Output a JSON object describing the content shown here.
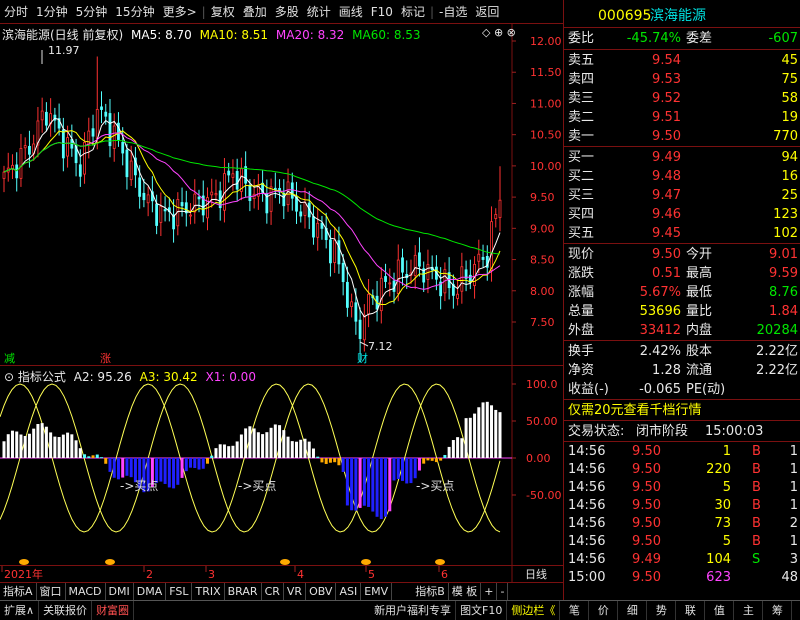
{
  "toolbar": {
    "items": [
      "分时",
      "1分钟",
      "5分钟",
      "15分钟",
      "更多>",
      "复权",
      "叠加",
      "多股",
      "统计",
      "画线",
      "F10",
      "标记",
      "-自选",
      "返回"
    ]
  },
  "main": {
    "title": "滨海能源(日线 前复权)",
    "ma5": "MA5: 8.70",
    "ma10": "MA10: 8.51",
    "ma20": "MA20: 8.32",
    "ma60": "MA60: 8.53",
    "high_label": "11.97",
    "low_label": "7.12",
    "marker_jian": "减",
    "marker_zhang": "涨",
    "marker_cai": "财",
    "price_ticks": [
      "12.00",
      "11.50",
      "11.00",
      "10.50",
      "10.00",
      "9.50",
      "9.00",
      "8.50",
      "8.00",
      "7.50"
    ]
  },
  "sub": {
    "title": "指标公式",
    "a2": "A2: 95.26",
    "a3": "A3: 30.42",
    "x1": "X1: 0.00",
    "ticks": [
      "100.0",
      "50.00",
      "0.00",
      "-50.00"
    ],
    "buy_label": "买点"
  },
  "time_axis": {
    "labels": [
      "2021年",
      "2",
      "3",
      "4",
      "5",
      "6"
    ],
    "period": "日线"
  },
  "tabs": [
    "指标A",
    "窗口",
    "MACD",
    "DMI",
    "DMA",
    "FSL",
    "TRIX",
    "BRAR",
    "CR",
    "VR",
    "OBV",
    "ASI",
    "EMV",
    "指标B",
    "模 板",
    "+",
    "-"
  ],
  "status": {
    "items": [
      "扩展∧",
      "关联报价",
      "财富圈",
      "新用户福利专享",
      "图文F10",
      "侧边栏《"
    ],
    "right": [
      "笔",
      "价",
      "细",
      "势",
      "联",
      "值",
      "主",
      "筹"
    ]
  },
  "quote": {
    "code": "000695",
    "name": "滨海能源",
    "weibi_label": "委比",
    "weibi": "-45.74%",
    "weicha_label": "委差",
    "weicha": "-607",
    "asks": [
      {
        "label": "卖五",
        "price": "9.54",
        "vol": "45"
      },
      {
        "label": "卖四",
        "price": "9.53",
        "vol": "75"
      },
      {
        "label": "卖三",
        "price": "9.52",
        "vol": "58"
      },
      {
        "label": "卖二",
        "price": "9.51",
        "vol": "19"
      },
      {
        "label": "卖一",
        "price": "9.50",
        "vol": "770"
      }
    ],
    "bids": [
      {
        "label": "买一",
        "price": "9.49",
        "vol": "94"
      },
      {
        "label": "买二",
        "price": "9.48",
        "vol": "16"
      },
      {
        "label": "买三",
        "price": "9.47",
        "vol": "25"
      },
      {
        "label": "买四",
        "price": "9.46",
        "vol": "123"
      },
      {
        "label": "买五",
        "price": "9.45",
        "vol": "102"
      }
    ],
    "stats": [
      {
        "l1": "现价",
        "v1": "9.50",
        "c1": "red",
        "l2": "今开",
        "v2": "9.01",
        "c2": "red"
      },
      {
        "l1": "涨跌",
        "v1": "0.51",
        "c1": "red",
        "l2": "最高",
        "v2": "9.59",
        "c2": "red"
      },
      {
        "l1": "涨幅",
        "v1": "5.67%",
        "c1": "red",
        "l2": "最低",
        "v2": "8.76",
        "c2": "green"
      },
      {
        "l1": "总量",
        "v1": "53696",
        "c1": "yellow",
        "l2": "量比",
        "v2": "1.84",
        "c2": "red"
      },
      {
        "l1": "外盘",
        "v1": "33412",
        "c1": "red",
        "l2": "内盘",
        "v2": "20284",
        "c2": "green"
      }
    ],
    "stats2": [
      {
        "l1": "换手",
        "v1": "2.42%",
        "l2": "股本",
        "v2": "2.22亿"
      },
      {
        "l1": "净资",
        "v1": "1.28",
        "l2": "流通",
        "v2": "2.22亿"
      },
      {
        "l1": "收益(-)",
        "v1": "-0.065",
        "l2": "PE(动)",
        "v2": ""
      }
    ],
    "promo": "仅需20元查看千档行情",
    "state_label": "交易状态:",
    "state_value": "闭市阶段",
    "state_time": "15:00:03",
    "trades": [
      {
        "t": "14:56",
        "p": "9.50",
        "v": "1",
        "s": "B",
        "n": "1"
      },
      {
        "t": "14:56",
        "p": "9.50",
        "v": "220",
        "s": "B",
        "n": "1"
      },
      {
        "t": "14:56",
        "p": "9.50",
        "v": "5",
        "s": "B",
        "n": "1"
      },
      {
        "t": "14:56",
        "p": "9.50",
        "v": "30",
        "s": "B",
        "n": "1"
      },
      {
        "t": "14:56",
        "p": "9.50",
        "v": "73",
        "s": "B",
        "n": "2"
      },
      {
        "t": "14:56",
        "p": "9.50",
        "v": "5",
        "s": "B",
        "n": "1"
      },
      {
        "t": "14:56",
        "p": "9.49",
        "v": "104",
        "s": "S",
        "n": "3"
      },
      {
        "t": "15:00",
        "p": "9.50",
        "v": "623",
        "s": "",
        "n": "48"
      }
    ]
  },
  "colors": {
    "up": "#ff3232",
    "down": "#54ffff",
    "ma5": "#ffffff",
    "ma10": "#ffff00",
    "ma20": "#ff44ff",
    "ma60": "#00e600",
    "border": "#7a1010"
  }
}
